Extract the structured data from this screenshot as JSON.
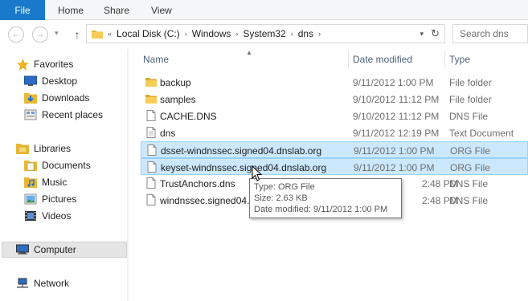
{
  "ribbon": {
    "tabs": [
      {
        "label": "File",
        "active": true
      },
      {
        "label": "Home"
      },
      {
        "label": "Share"
      },
      {
        "label": "View"
      }
    ],
    "accent_color": "#1979ca"
  },
  "address_bar": {
    "overflow": "«",
    "crumbs": [
      "Local Disk (C:)",
      "Windows",
      "System32",
      "dns"
    ],
    "separator": "›"
  },
  "search": {
    "placeholder": "Search dns"
  },
  "nav_pane": {
    "favorites": {
      "label": "Favorites",
      "icon": "star-icon",
      "items": [
        {
          "label": "Desktop",
          "icon": "desktop-icon"
        },
        {
          "label": "Downloads",
          "icon": "downloads-icon"
        },
        {
          "label": "Recent places",
          "icon": "recent-places-icon"
        }
      ]
    },
    "libraries": {
      "label": "Libraries",
      "icon": "libraries-icon",
      "items": [
        {
          "label": "Documents",
          "icon": "documents-icon"
        },
        {
          "label": "Music",
          "icon": "music-icon"
        },
        {
          "label": "Pictures",
          "icon": "pictures-icon"
        },
        {
          "label": "Videos",
          "icon": "videos-icon"
        }
      ]
    },
    "computer": {
      "label": "Computer",
      "icon": "computer-icon",
      "selected": true
    },
    "network": {
      "label": "Network",
      "icon": "network-icon"
    }
  },
  "file_list": {
    "columns": {
      "name": "Name",
      "date_modified": "Date modified",
      "type": "Type"
    },
    "rows": [
      {
        "name": "backup",
        "date": "9/11/2012 1:00 PM",
        "type": "File folder",
        "icon": "folder-icon"
      },
      {
        "name": "samples",
        "date": "9/10/2012 11:12 PM",
        "type": "File folder",
        "icon": "folder-icon"
      },
      {
        "name": "CACHE.DNS",
        "date": "9/10/2012 11:12 PM",
        "type": "DNS File",
        "icon": "file-icon"
      },
      {
        "name": "dns",
        "date": "9/11/2012 12:19 PM",
        "type": "Text Document",
        "icon": "file-icon"
      },
      {
        "name": "dsset-windnssec.signed04.dnslab.org",
        "date": "9/11/2012 1:00 PM",
        "type": "ORG File",
        "icon": "file-icon",
        "selected": true
      },
      {
        "name": "keyset-windnssec.signed04.dnslab.org",
        "date": "9/11/2012 1:00 PM",
        "type": "ORG File",
        "icon": "file-icon",
        "selected": true
      },
      {
        "name": "TrustAnchors.dns",
        "date": "2:48 PM",
        "type": "DNS File",
        "icon": "file-icon"
      },
      {
        "name": "windnssec.signed04.d",
        "date": "2:48 PM",
        "type": "DNS File",
        "icon": "file-icon"
      }
    ]
  },
  "tooltip": {
    "type_line": "Type: ORG File",
    "size_line": "Size: 2.63 KB",
    "date_line": "Date modified: 9/11/2012 1:00 PM"
  },
  "colors": {
    "selection_bg": "#cce8ff",
    "selection_border": "#99d1ff",
    "header_text": "#4c607a",
    "folder_yellow": "#e8b835"
  }
}
